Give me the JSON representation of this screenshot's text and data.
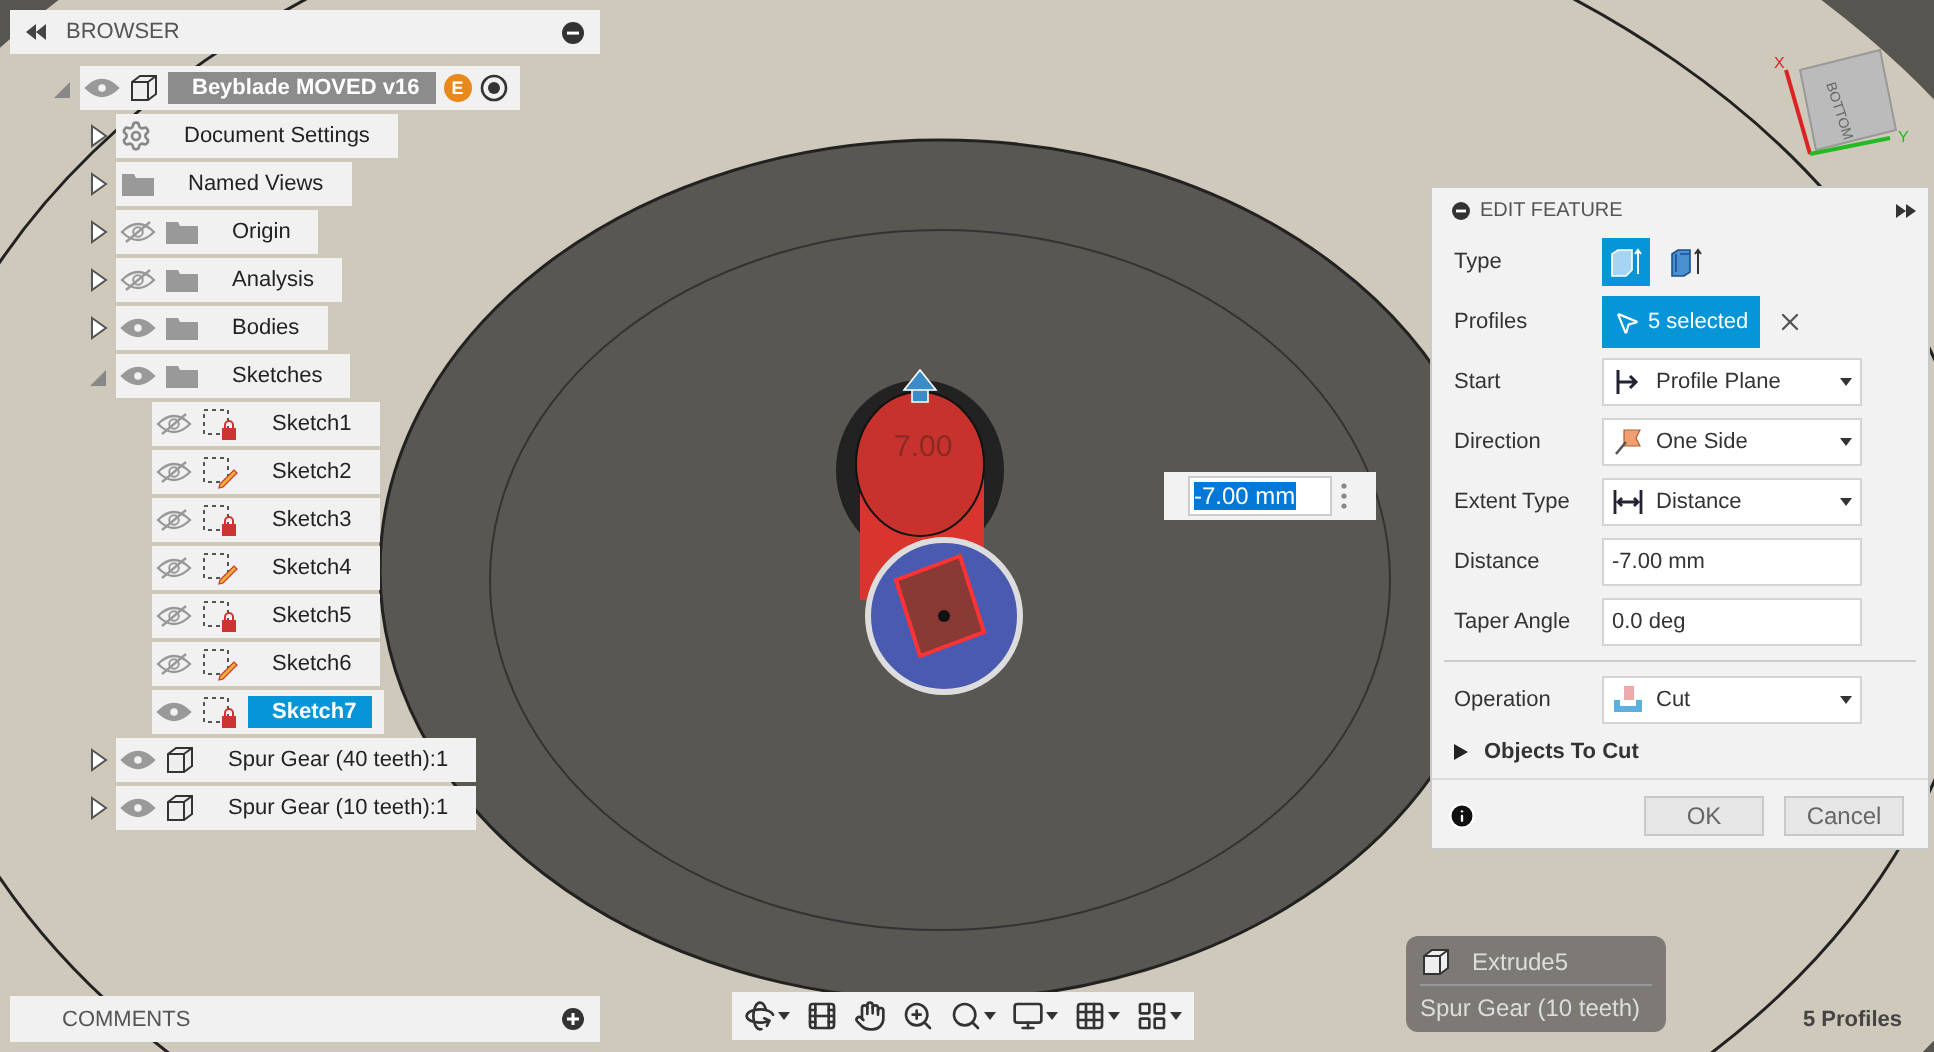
{
  "browser": {
    "title": "BROWSER",
    "tree": {
      "label": "Beyblade MOVED v16",
      "kind": "root",
      "badge": "E",
      "active": true,
      "visible": true,
      "expanded": true,
      "selected": false,
      "children": [
        {
          "label": "Document Settings",
          "kind": "settings",
          "expanded": false,
          "selected": false
        },
        {
          "label": "Named Views",
          "kind": "folder",
          "expanded": false,
          "selected": false
        },
        {
          "label": "Origin",
          "kind": "folder",
          "visible": false,
          "expanded": false,
          "selected": false
        },
        {
          "label": "Analysis",
          "kind": "folder",
          "visible": false,
          "expanded": false,
          "selected": false
        },
        {
          "label": "Bodies",
          "kind": "folder",
          "visible": true,
          "expanded": false,
          "selected": false
        },
        {
          "label": "Sketches",
          "kind": "folder",
          "visible": true,
          "expanded": true,
          "selected": false,
          "children": [
            {
              "label": "Sketch1",
              "kind": "sketch",
              "editable": false,
              "visible": false,
              "selected": false
            },
            {
              "label": "Sketch2",
              "kind": "sketch",
              "editable": true,
              "visible": false,
              "selected": false
            },
            {
              "label": "Sketch3",
              "kind": "sketch",
              "editable": false,
              "visible": false,
              "selected": false
            },
            {
              "label": "Sketch4",
              "kind": "sketch",
              "editable": true,
              "visible": false,
              "selected": false
            },
            {
              "label": "Sketch5",
              "kind": "sketch",
              "editable": false,
              "visible": false,
              "selected": false
            },
            {
              "label": "Sketch6",
              "kind": "sketch",
              "editable": true,
              "visible": false,
              "selected": false
            },
            {
              "label": "Sketch7",
              "kind": "sketch",
              "editable": false,
              "visible": true,
              "selected": true
            }
          ]
        },
        {
          "label": "Spur Gear (40 teeth):1",
          "kind": "component",
          "visible": true,
          "expanded": false,
          "selected": false
        },
        {
          "label": "Spur Gear (10 teeth):1",
          "kind": "component",
          "visible": true,
          "expanded": false,
          "selected": false
        }
      ]
    }
  },
  "comments": {
    "title": "COMMENTS"
  },
  "scene": {
    "dimension_label": "7.00",
    "distance_input": {
      "value": "-7.00 mm",
      "text_selected": true
    },
    "view_cube": {
      "face": "BOTTOM",
      "axes": [
        "X",
        "Y"
      ]
    }
  },
  "edit_feature": {
    "title": "EDIT FEATURE",
    "rows": [
      {
        "kind": "type",
        "label": "Type",
        "options": [
          {
            "kind": "extrude",
            "selected": true
          },
          {
            "kind": "thin",
            "selected": false
          }
        ]
      },
      {
        "kind": "selection",
        "label": "Profiles",
        "value": "5 selected"
      },
      {
        "kind": "select",
        "label": "Start",
        "value": "Profile Plane"
      },
      {
        "kind": "select",
        "label": "Direction",
        "value": "One Side"
      },
      {
        "kind": "select",
        "label": "Extent Type",
        "value": "Distance"
      },
      {
        "kind": "input",
        "label": "Distance",
        "value": "-7.00 mm"
      },
      {
        "kind": "input",
        "label": "Taper Angle",
        "value": "0.0 deg"
      }
    ],
    "lower_rows": [
      {
        "kind": "select",
        "label": "Operation",
        "value": "Cut"
      },
      {
        "kind": "section",
        "label": "Objects To Cut",
        "expanded": false
      }
    ],
    "buttons": [
      {
        "label": "OK"
      },
      {
        "label": "Cancel"
      }
    ]
  },
  "toolbar": [
    {
      "dropdown": true
    },
    {
      "dropdown": false
    },
    {
      "dropdown": false
    },
    {
      "dropdown": false
    },
    {
      "dropdown": true
    },
    {
      "dropdown": true
    },
    {
      "dropdown": true
    },
    {
      "dropdown": true
    }
  ],
  "tooltip": {
    "title": "Extrude5",
    "subtitle": "Spur Gear (10 teeth)"
  },
  "status": "5 Profiles"
}
